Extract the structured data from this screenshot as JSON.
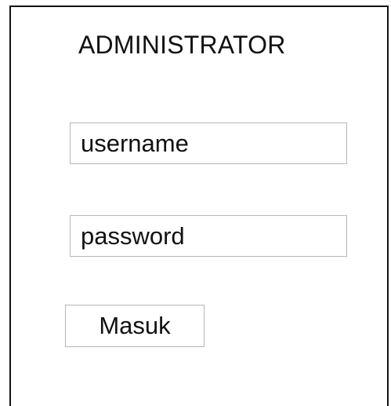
{
  "login_form": {
    "title": "ADMINISTRATOR",
    "username_placeholder": "username",
    "password_placeholder": "password",
    "submit_label": "Masuk"
  }
}
